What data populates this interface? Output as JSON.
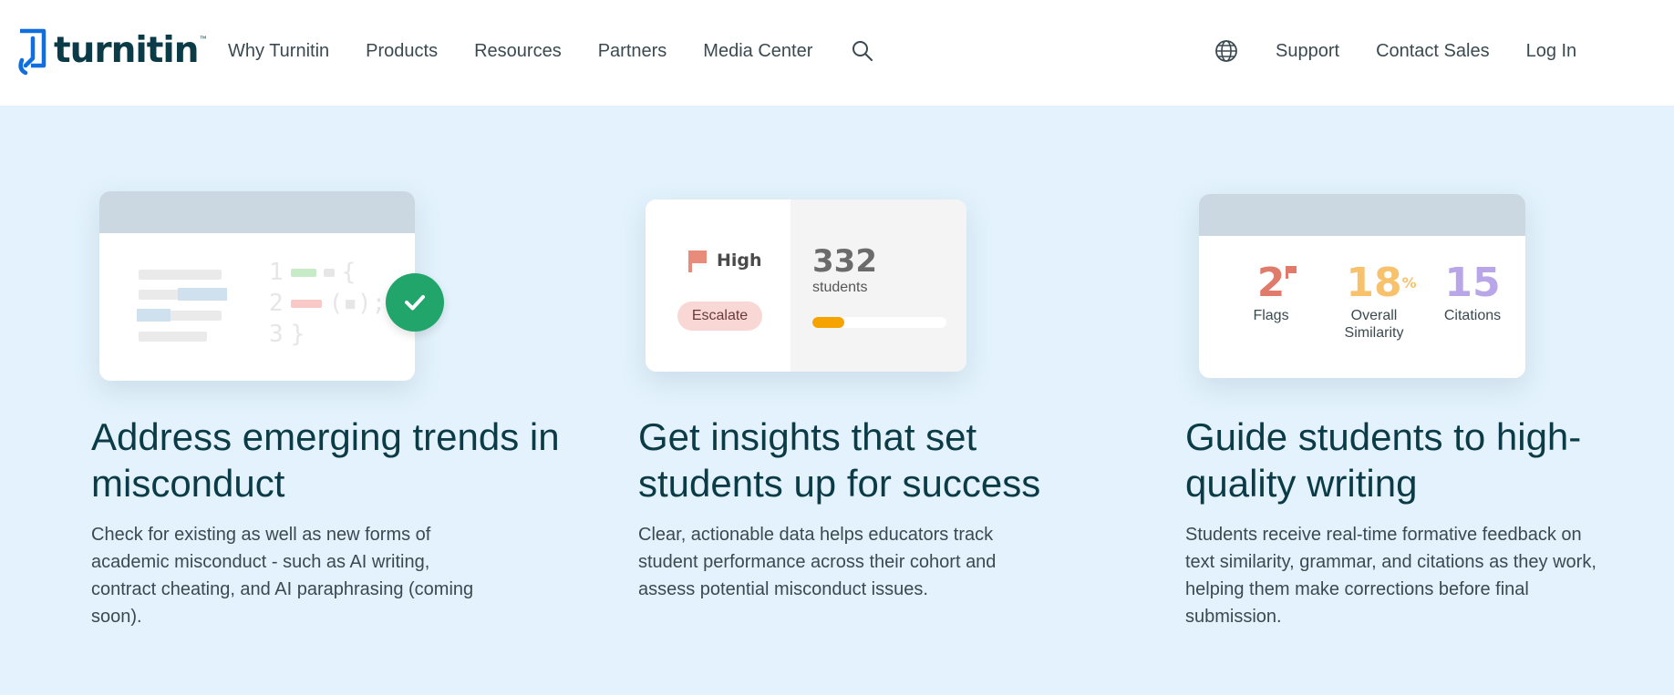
{
  "brand": {
    "name": "turnitin",
    "tm": "™",
    "accent": "#0f6fde"
  },
  "nav": {
    "left": [
      "Why Turnitin",
      "Products",
      "Resources",
      "Partners",
      "Media Center"
    ],
    "right": [
      "Support",
      "Contact Sales",
      "Log In"
    ],
    "icons": [
      "search-icon",
      "globe-icon"
    ]
  },
  "features": [
    {
      "title": "Address emerging trends in misconduct",
      "description": "Check for existing as well as new forms of academic misconduct - such as AI writing, contract cheating, and AI paraphrasing (coming soon).",
      "card": {
        "code_lines": [
          "1",
          "2",
          "3"
        ],
        "code_symbols": [
          "{",
          "(▪);",
          "}"
        ],
        "status_icon": "check-icon",
        "status_color": "#22a56a"
      }
    },
    {
      "title": "Get insights that set students up for success",
      "description": "Clear, actionable data helps educators track student performance across their cohort and assess potential misconduct issues.",
      "card": {
        "risk_label": "High",
        "action_label": "Escalate",
        "count": "332",
        "count_label": "students",
        "progress_percent": 24,
        "progress_color": "#f5a300",
        "flag_color": "#e88b7a"
      }
    },
    {
      "title": "Guide students to high-quality writing",
      "description": "Students receive real-time formative feedback on text similarity, grammar, and citations as they work, helping them make corrections before final submission.",
      "card": {
        "stats": [
          {
            "value": "2",
            "label": "Flags",
            "color": "#e07a6a"
          },
          {
            "value": "18",
            "suffix": "%",
            "label": "Overall Similarity",
            "color": "#f7c26b"
          },
          {
            "value": "15",
            "label": "Citations",
            "color": "#b9a6e8"
          }
        ]
      }
    }
  ]
}
